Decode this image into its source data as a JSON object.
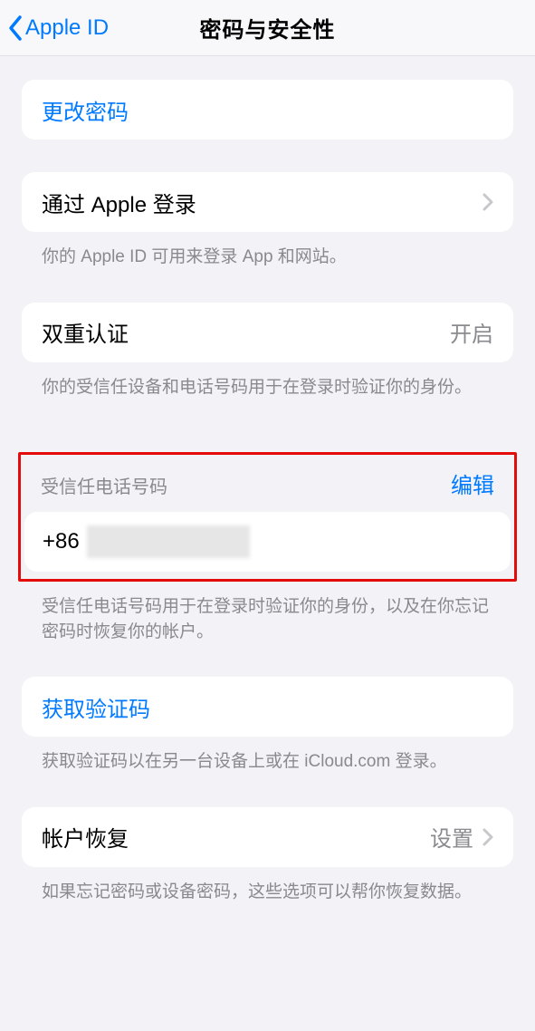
{
  "nav": {
    "back_label": "Apple ID",
    "title": "密码与安全性"
  },
  "change_password": {
    "label": "更改密码"
  },
  "sign_in_with_apple": {
    "label": "通过 Apple 登录",
    "footer": "你的 Apple ID 可用来登录 App 和网站。"
  },
  "two_factor": {
    "label": "双重认证",
    "value": "开启",
    "footer": "你的受信任设备和电话号码用于在登录时验证你的身份。"
  },
  "trusted_phone": {
    "section_title": "受信任电话号码",
    "edit": "编辑",
    "prefix": "+86",
    "footer": "受信任电话号码用于在登录时验证你的身份，以及在你忘记密码时恢复你的帐户。"
  },
  "get_code": {
    "label": "获取验证码",
    "footer": "获取验证码以在另一台设备上或在 iCloud.com 登录。"
  },
  "account_recovery": {
    "label": "帐户恢复",
    "value": "设置",
    "footer": "如果忘记密码或设备密码，这些选项可以帮你恢复数据。"
  },
  "colors": {
    "accent": "#007aff"
  }
}
